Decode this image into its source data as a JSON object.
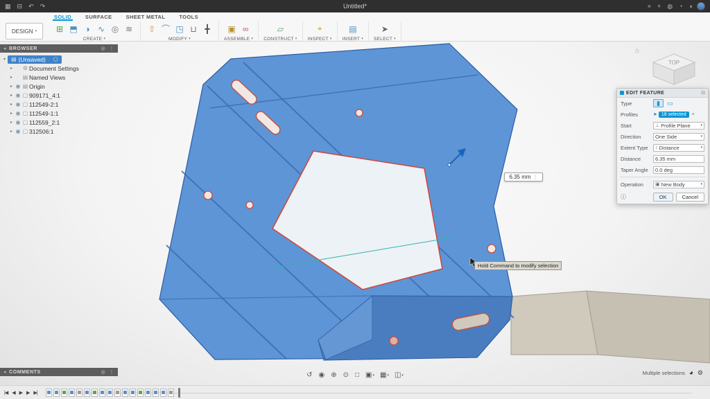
{
  "colors": {
    "accent": "#0696d7",
    "selection_blue": "#3f82c9",
    "part_blue": "#5e95d6",
    "part_dark_blue": "#4a7dbf",
    "bend_line": "#3c6db6",
    "hole_outline": "#cb4a3e",
    "tan_body": "#cfcabc"
  },
  "titlebar": {
    "title": "Untitled*",
    "left_icons": [
      {
        "name": "app-grid-icon",
        "glyph": "▦"
      },
      {
        "name": "save-icon",
        "glyph": "⊟"
      },
      {
        "name": "undo-icon",
        "glyph": "↶"
      },
      {
        "name": "redo-icon",
        "glyph": "↷"
      }
    ],
    "right_icons": [
      {
        "name": "close-tab-icon",
        "glyph": "×"
      },
      {
        "name": "add-tab-icon",
        "glyph": "+"
      },
      {
        "name": "job-status-icon",
        "glyph": "◍"
      },
      {
        "name": "help-icon",
        "glyph": "◔"
      },
      {
        "name": "notifications-icon",
        "glyph": "◖"
      }
    ]
  },
  "ribbon": {
    "caret_glyph": "▾",
    "design_label": "DESIGN",
    "tabs": [
      {
        "label": "SOLID",
        "cls": "active"
      },
      {
        "label": "SURFACE",
        "cls": ""
      },
      {
        "label": "SHEET METAL",
        "cls": ""
      },
      {
        "label": "TOOLS",
        "cls": ""
      }
    ],
    "groups": [
      {
        "label": "CREATE",
        "icons": [
          {
            "name": "new-sketch-icon",
            "glyph": "⊞",
            "color": "#4e9d4e"
          },
          {
            "name": "extrude-icon",
            "glyph": "⬒",
            "color": "#4a90c4"
          },
          {
            "name": "revolve-icon",
            "glyph": "◑",
            "color": "#4a90c4"
          },
          {
            "name": "sweep-icon",
            "glyph": "∿",
            "color": "#4a90c4"
          },
          {
            "name": "hole-icon",
            "glyph": "◎",
            "color": "#777777"
          },
          {
            "name": "thread-icon",
            "glyph": "≋",
            "color": "#777777"
          }
        ]
      },
      {
        "label": "MODIFY",
        "icons": [
          {
            "name": "press-pull-icon",
            "glyph": "⇧",
            "color": "#e08f2e"
          },
          {
            "name": "fillet-icon",
            "glyph": "⌒",
            "color": "#4a90c4"
          },
          {
            "name": "shell-icon",
            "glyph": "◳",
            "color": "#4a90c4"
          },
          {
            "name": "combine-icon",
            "glyph": "⊔",
            "color": "#777777"
          },
          {
            "name": "move-copy-icon",
            "glyph": "╋",
            "color": "#555555"
          }
        ]
      },
      {
        "label": "ASSEMBLE",
        "icons": [
          {
            "name": "new-component-icon",
            "glyph": "▣",
            "color": "#b8912f"
          },
          {
            "name": "joint-icon",
            "glyph": "∞",
            "color": "#b05c8a"
          }
        ]
      },
      {
        "label": "CONSTRUCT",
        "icons": [
          {
            "name": "construction-plane-icon",
            "glyph": "▱",
            "color": "#57a773"
          }
        ]
      },
      {
        "label": "INSPECT",
        "icons": [
          {
            "name": "measure-icon",
            "glyph": "⌖",
            "color": "#c99a2e"
          }
        ]
      },
      {
        "label": "INSERT",
        "icons": [
          {
            "name": "insert-icon",
            "glyph": "▤",
            "color": "#4a90c4"
          }
        ]
      },
      {
        "label": "SELECT",
        "icons": [
          {
            "name": "select-cursor-icon",
            "glyph": "➤",
            "color": "#666666"
          }
        ]
      }
    ]
  },
  "browser": {
    "header": "BROWSER",
    "collapse": "◂",
    "actions": [
      "◎",
      "⋮"
    ],
    "root": {
      "expander": "▾",
      "icon_glyph": "▤",
      "label": "(Unsaved)",
      "radio_glyph": "◯"
    },
    "items": [
      {
        "expander": "▸",
        "eye": "",
        "icon_glyph": "⚙",
        "label": "Document Settings"
      },
      {
        "expander": "▸",
        "eye": "",
        "icon_glyph": "▤",
        "label": "Named Views"
      },
      {
        "expander": "▸",
        "eye": "◉",
        "icon_glyph": "▤",
        "label": "Origin"
      },
      {
        "expander": "▸",
        "eye": "◉",
        "icon_glyph": "▢",
        "label": "909171_4:1"
      },
      {
        "expander": "▸",
        "eye": "◉",
        "icon_glyph": "▢",
        "label": "112549-2:1"
      },
      {
        "expander": "▸",
        "eye": "◉",
        "icon_glyph": "▢",
        "label": "112549-1:1"
      },
      {
        "expander": "▸",
        "eye": "◉",
        "icon_glyph": "▢",
        "label": "112559_2:1"
      },
      {
        "expander": "▸",
        "eye": "◉",
        "icon_glyph": "▢",
        "label": "312506:1"
      }
    ]
  },
  "canvas": {
    "viewcube_label": "TOP",
    "home_glyph": "⌂",
    "dim_value": "6.35 mm",
    "spinner_glyph": "⋮",
    "tooltip": "Hold Command to modify selection"
  },
  "dialog": {
    "title": "EDIT FEATURE",
    "pin_glyph": "⊟",
    "type_icons": [
      "▮",
      "▭"
    ],
    "cursor_glyph": "➤",
    "clear_glyph": "×",
    "info_glyph": "ⓘ",
    "rows": [
      {
        "label": "Type"
      },
      {
        "label": "Profiles",
        "value": "18 selected"
      },
      {
        "label": "Start",
        "value": "Profile Plane",
        "icon": "⊥"
      },
      {
        "label": "Direction",
        "value": "One Side",
        "icon": ""
      },
      {
        "label": "Extent Type",
        "value": "Distance",
        "icon": "↕"
      },
      {
        "label": "Distance",
        "value": "6.35 mm"
      },
      {
        "label": "Taper Angle",
        "value": "0.0 deg"
      },
      {
        "label": "Operation",
        "value": "New Body",
        "icon": "▣"
      }
    ],
    "ok_label": "OK",
    "cancel_label": "Cancel"
  },
  "navbar": {
    "items": [
      {
        "name": "orbit-icon",
        "glyph": "↺",
        "caret": ""
      },
      {
        "name": "look-at-icon",
        "glyph": "◉",
        "caret": ""
      },
      {
        "name": "pan-icon",
        "glyph": "⊕",
        "caret": ""
      },
      {
        "name": "zoom-icon",
        "glyph": "⊙",
        "caret": ""
      },
      {
        "name": "fit-view-icon",
        "glyph": "□",
        "caret": ""
      },
      {
        "name": "display-settings-icon",
        "glyph": "▣",
        "caret": "▾"
      },
      {
        "name": "grid-settings-icon",
        "glyph": "▦",
        "caret": "▾"
      },
      {
        "name": "viewports-icon",
        "glyph": "◫",
        "caret": "▾"
      }
    ]
  },
  "comments": {
    "header": "COMMENTS",
    "collapse": "◂",
    "actions": [
      "◎",
      "⋮"
    ]
  },
  "status": {
    "text": "Multiple selections",
    "icon_glyph": "◕",
    "gear_glyph": "⚙"
  },
  "timeline": {
    "controls": [
      {
        "name": "go-to-start-button",
        "glyph": "|◀"
      },
      {
        "name": "step-back-button",
        "glyph": "◀"
      },
      {
        "name": "play-button",
        "glyph": "▶"
      },
      {
        "name": "step-forward-button",
        "glyph": "▶"
      },
      {
        "name": "go-to-end-button",
        "glyph": "▶|"
      }
    ],
    "items": [
      {
        "color": "c-blue"
      },
      {
        "color": "c-blue"
      },
      {
        "color": "c-green"
      },
      {
        "color": "c-blue"
      },
      {
        "color": "c-gray"
      },
      {
        "color": "c-blue"
      },
      {
        "color": "c-green"
      },
      {
        "color": "c-blue"
      },
      {
        "color": "c-blue"
      },
      {
        "color": "c-gray"
      },
      {
        "color": "c-blue"
      },
      {
        "color": "c-blue"
      },
      {
        "color": "c-green"
      },
      {
        "color": "c-blue"
      },
      {
        "color": "c-blue"
      },
      {
        "color": "c-blue"
      },
      {
        "color": "c-gray"
      }
    ]
  }
}
